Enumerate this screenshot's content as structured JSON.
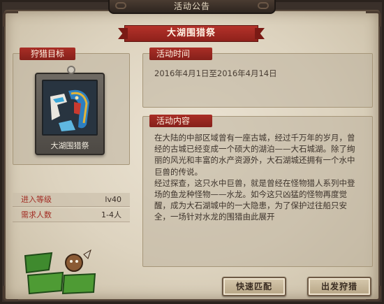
{
  "window": {
    "title": "活动公告"
  },
  "event": {
    "title": "大湖围猎祭"
  },
  "target": {
    "section_label": "狩猎目标",
    "monster_name": "大湖围猎祭",
    "stats": [
      {
        "label": "进入等级",
        "value": "lv40"
      },
      {
        "label": "需求人数",
        "value": "1-4人"
      }
    ]
  },
  "time": {
    "section_label": "活动时间",
    "text": "2016年4月1日至2016年4月14日"
  },
  "content": {
    "section_label": "活动内容",
    "paragraphs": [
      "在大陆的中部区域曾有一座古城，经过千万年的岁月，曾经的古城已经变成一个硕大的湖泊——大石城湖。除了绚丽的风光和丰富的水产资源外，大石湖城还拥有一个水中巨兽的传说。",
      "经过探查，这只水中巨兽，就是曾经在怪物猎人系列中登场的鱼龙种怪物——水龙。如今这只凶猛的怪物再度觉醒，成为大石湖城中的一大隐患，为了保护过往船只安全，一场针对水龙的围猎由此展开"
    ]
  },
  "buttons": {
    "quick_match": "快速匹配",
    "start_hunt": "出发狩猎"
  },
  "icons": {
    "monster": "water-dragon-icon",
    "logo": "site-logo"
  },
  "colors": {
    "ribbon": "#a92e26",
    "parchment": "#e4dccb",
    "frame": "#3a302a"
  }
}
